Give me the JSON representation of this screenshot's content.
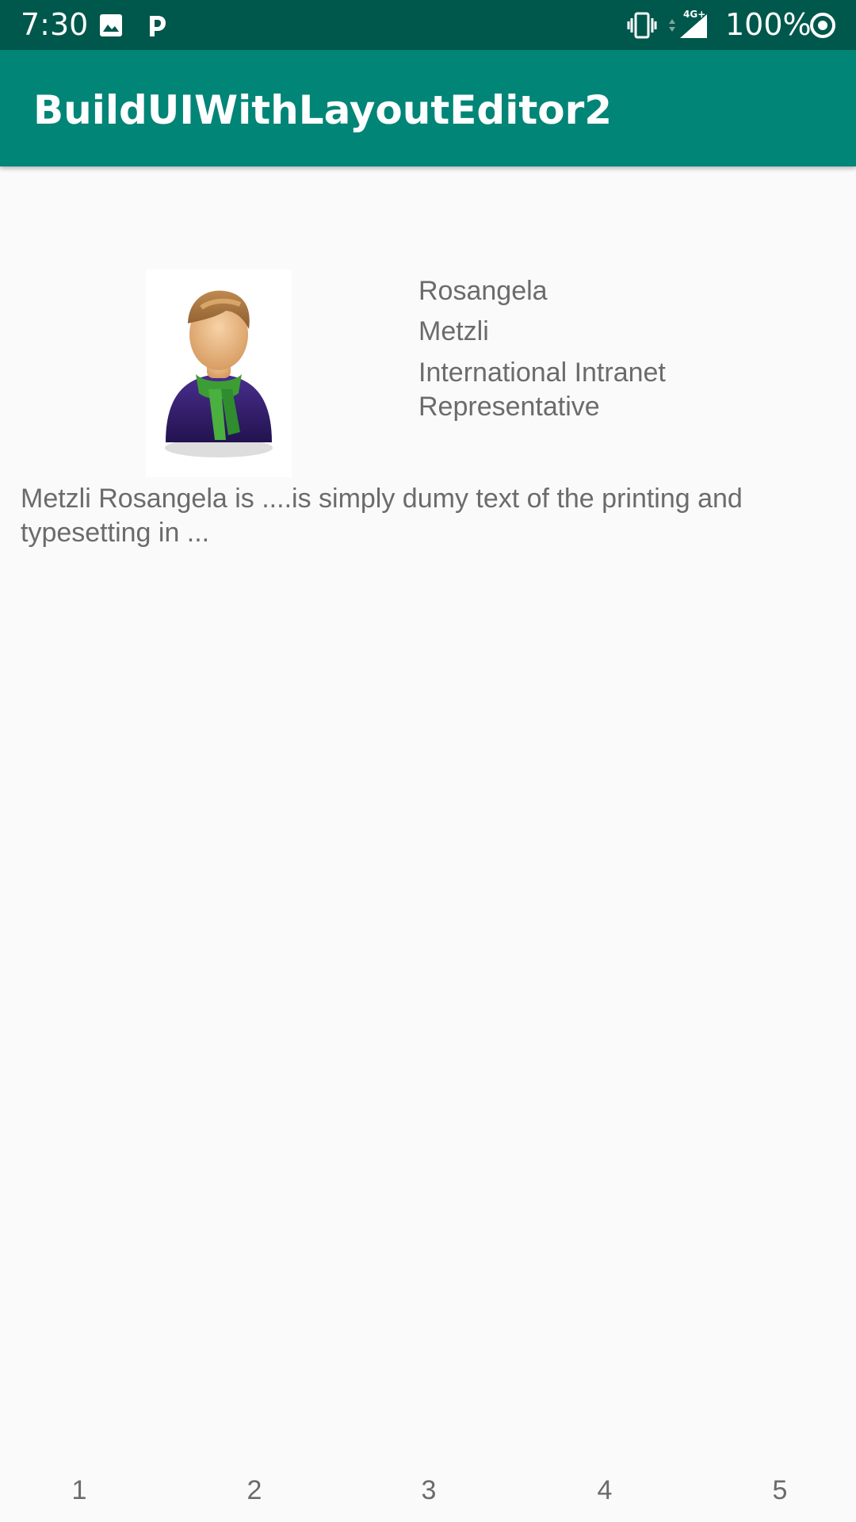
{
  "status_bar": {
    "time": "7:30",
    "battery": "100%",
    "network": "4G+",
    "left_icons": [
      "image-icon",
      "parking-icon"
    ],
    "right_icons": [
      "vibrate-icon",
      "signal-icon",
      "sync-icon"
    ]
  },
  "app_bar": {
    "title": "BuildUIWithLayoutEditor2"
  },
  "profile": {
    "avatar": "person-avatar",
    "first_name": "Rosangela",
    "last_name": "Metzli",
    "job_title": "International Intranet Representative",
    "description": "Metzli Rosangela is ....is simply dumy text of the printing and typesetting in ..."
  },
  "bottom_tabs": [
    "1",
    "2",
    "3",
    "4",
    "5"
  ],
  "colors": {
    "status_bar": "#00574b",
    "app_bar": "#008577",
    "background": "#fafafa",
    "text_secondary": "#6b6b6b"
  }
}
